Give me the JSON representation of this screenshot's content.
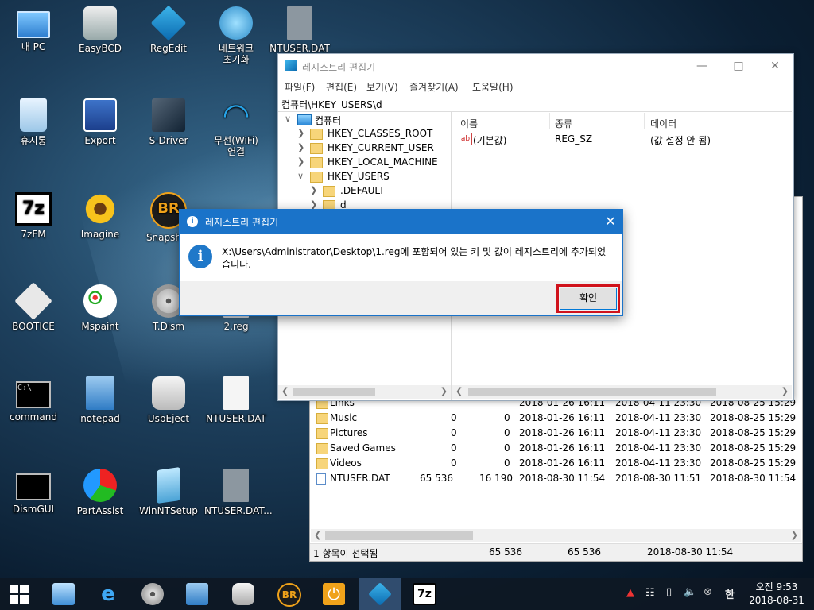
{
  "desktop": {
    "icons": [
      {
        "label": "내 PC",
        "icon": "computer-icon"
      },
      {
        "label": "EasyBCD",
        "icon": "easybcd-icon"
      },
      {
        "label": "RegEdit",
        "icon": "regedit-icon"
      },
      {
        "label": "네트워크 초기화",
        "line1": "네트워크",
        "line2": "초기화",
        "icon": "network-icon"
      },
      {
        "label": "NTUSER.DAT",
        "icon": "file-icon"
      },
      {
        "label": "휴지통",
        "icon": "recycle-bin-icon"
      },
      {
        "label": "Export",
        "icon": "export-icon"
      },
      {
        "label": "S-Driver",
        "icon": "driver-icon"
      },
      {
        "label": "무선(WiFi) 연결",
        "line1": "무선(WiFi)",
        "line2": "연결",
        "icon": "wifi-icon"
      },
      {
        "label": "7zFM",
        "icon": "7zip-icon"
      },
      {
        "label": "Imagine",
        "icon": "imagine-icon"
      },
      {
        "label": "Snapshot",
        "icon": "snapshot-icon"
      },
      {
        "label": "BOOTICE",
        "icon": "floppy-icon"
      },
      {
        "label": "Mspaint",
        "icon": "paint-icon"
      },
      {
        "label": "T.Dism",
        "icon": "dism-icon"
      },
      {
        "label": "2.reg",
        "icon": "reg-file-icon"
      },
      {
        "label": "command",
        "icon": "console-icon"
      },
      {
        "label": "notepad",
        "icon": "notepad-icon"
      },
      {
        "label": "UsbEject",
        "icon": "usb-icon"
      },
      {
        "label": "NTUSER.DAT",
        "icon": "file-icon"
      },
      {
        "label": "DismGUI",
        "icon": "console-icon"
      },
      {
        "label": "PartAssist",
        "icon": "partition-icon"
      },
      {
        "label": "WinNTSetup",
        "icon": "setup-icon"
      },
      {
        "label": "NTUSER.DAT...",
        "icon": "file-icon"
      }
    ]
  },
  "explorer": {
    "rows": [
      {
        "name": "Links",
        "c1": "",
        "c2": "",
        "d1": "2018-01-26 16:11",
        "d2": "2018-04-11 23:30",
        "d3": "2018-08-25 15:29"
      },
      {
        "name": "Music",
        "c1": "0",
        "c2": "0",
        "d1": "2018-01-26 16:11",
        "d2": "2018-04-11 23:30",
        "d3": "2018-08-25 15:29"
      },
      {
        "name": "Pictures",
        "c1": "0",
        "c2": "0",
        "d1": "2018-01-26 16:11",
        "d2": "2018-04-11 23:30",
        "d3": "2018-08-25 15:29"
      },
      {
        "name": "Saved Games",
        "c1": "0",
        "c2": "0",
        "d1": "2018-01-26 16:11",
        "d2": "2018-04-11 23:30",
        "d3": "2018-08-25 15:29"
      },
      {
        "name": "Videos",
        "c1": "0",
        "c2": "0",
        "d1": "2018-01-26 16:11",
        "d2": "2018-04-11 23:30",
        "d3": "2018-08-25 15:29"
      },
      {
        "name": "NTUSER.DAT",
        "c1": "65 536",
        "c2": "16 190",
        "d1": "2018-08-30 11:54",
        "d2": "2018-08-30 11:51",
        "d3": "2018-08-30 11:54"
      }
    ],
    "status": {
      "selected": "1 항목이 선택됨",
      "s1": "65 536",
      "s2": "65 536",
      "date": "2018-08-30 11:54"
    }
  },
  "regedit": {
    "title": "레지스트리 편집기",
    "menu": [
      "파일(F)",
      "편집(E)",
      "보기(V)",
      "즐겨찾기(A)",
      "도움말(H)"
    ],
    "address": "컴퓨터\\HKEY_USERS\\d",
    "tree": [
      {
        "label": "컴퓨터"
      },
      {
        "label": "HKEY_CLASSES_ROOT"
      },
      {
        "label": "HKEY_CURRENT_USER"
      },
      {
        "label": "HKEY_LOCAL_MACHINE"
      },
      {
        "label": "HKEY_USERS"
      },
      {
        "label": ".DEFAULT"
      },
      {
        "label": "d"
      }
    ],
    "columns": {
      "name": "이름",
      "type": "종류",
      "data": "데이터"
    },
    "values": [
      {
        "name": "(기본값)",
        "type": "REG_SZ",
        "data": "(값 설정 안 됨)"
      }
    ]
  },
  "dialog": {
    "title": "레지스트리 편집기",
    "message": "X:\\Users\\Administrator\\Desktop\\1.reg에 포함되어 있는 키 및 값이 레지스트리에 추가되었습니다.",
    "ok": "확인"
  },
  "taskbar": {
    "clock_time": "오전 9:53",
    "clock_date": "2018-08-31",
    "ime": "한"
  }
}
